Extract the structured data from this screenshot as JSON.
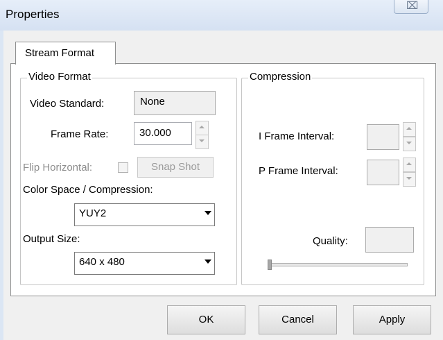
{
  "window": {
    "title": "Properties",
    "close_glyph": "⌧"
  },
  "tab": {
    "label": "Stream Format"
  },
  "video_format": {
    "group_label": "Video Format",
    "video_standard_label": "Video Standard:",
    "video_standard_value": "None",
    "frame_rate_label": "Frame Rate:",
    "frame_rate_value": "30.000",
    "flip_horizontal_label": "Flip Horizontal:",
    "snap_shot_label": "Snap Shot",
    "color_space_label": "Color Space / Compression:",
    "color_space_value": "YUY2",
    "output_size_label": "Output Size:",
    "output_size_value": "640 x 480"
  },
  "compression": {
    "group_label": "Compression",
    "i_frame_label": "I Frame Interval:",
    "i_frame_value": "",
    "p_frame_label": "P Frame Interval:",
    "p_frame_value": "",
    "quality_label": "Quality:",
    "quality_value": "",
    "quality_slider_level": 0
  },
  "buttons": {
    "ok": "OK",
    "cancel": "Cancel",
    "apply": "Apply"
  },
  "colors": {
    "titlebar": "#dbe6f4",
    "dialog_bg": "#f0f0f0",
    "panel_bg": "#ffffff"
  },
  "icons": [
    "close-icon",
    "spin-up-icon",
    "spin-down-icon",
    "dropdown-arrow-icon"
  ]
}
